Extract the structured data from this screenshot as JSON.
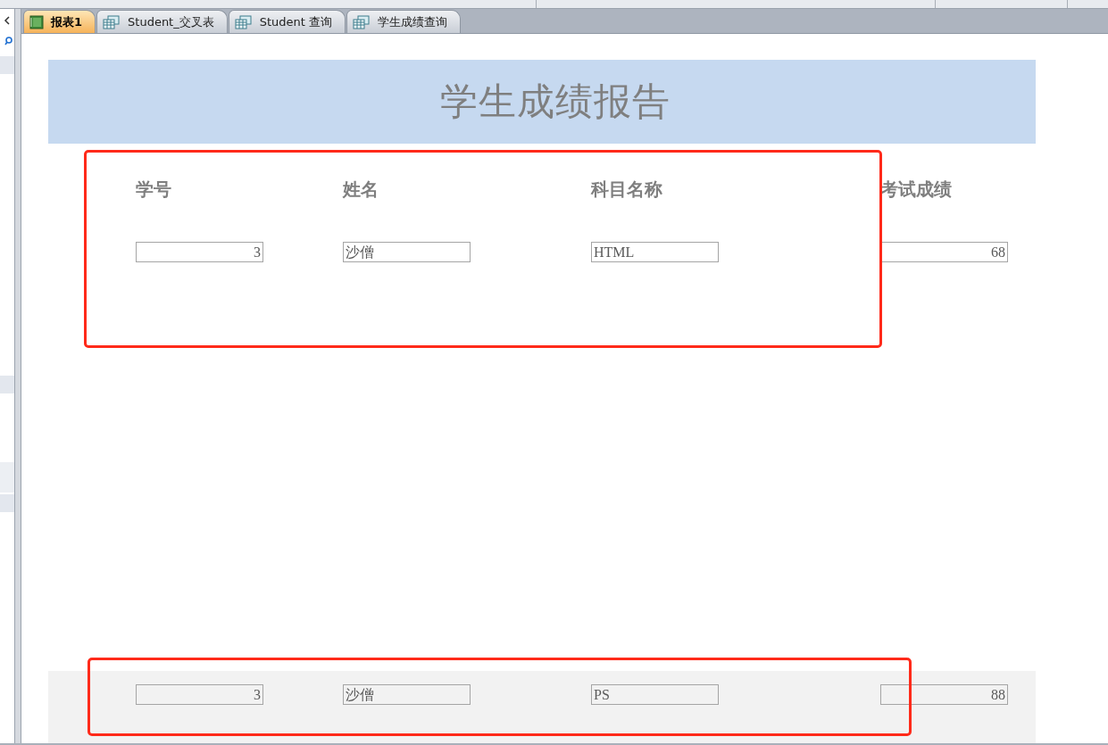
{
  "tabs": [
    {
      "label": "报表1",
      "kind": "report",
      "selected": true
    },
    {
      "label": "Student_交叉表",
      "kind": "query",
      "selected": false
    },
    {
      "label": "Student 查询",
      "kind": "query",
      "selected": false
    },
    {
      "label": "学生成绩查询",
      "kind": "query",
      "selected": false
    }
  ],
  "report": {
    "title": "学生成绩报告",
    "columns": [
      "学号",
      "姓名",
      "科目名称",
      "考试成绩"
    ],
    "records": [
      {
        "shaded": false,
        "fields": [
          "3",
          "沙僧",
          "HTML",
          "68"
        ]
      },
      {
        "shaded": true,
        "fields": [
          "3",
          "沙僧",
          "PS",
          "88"
        ]
      }
    ]
  }
}
